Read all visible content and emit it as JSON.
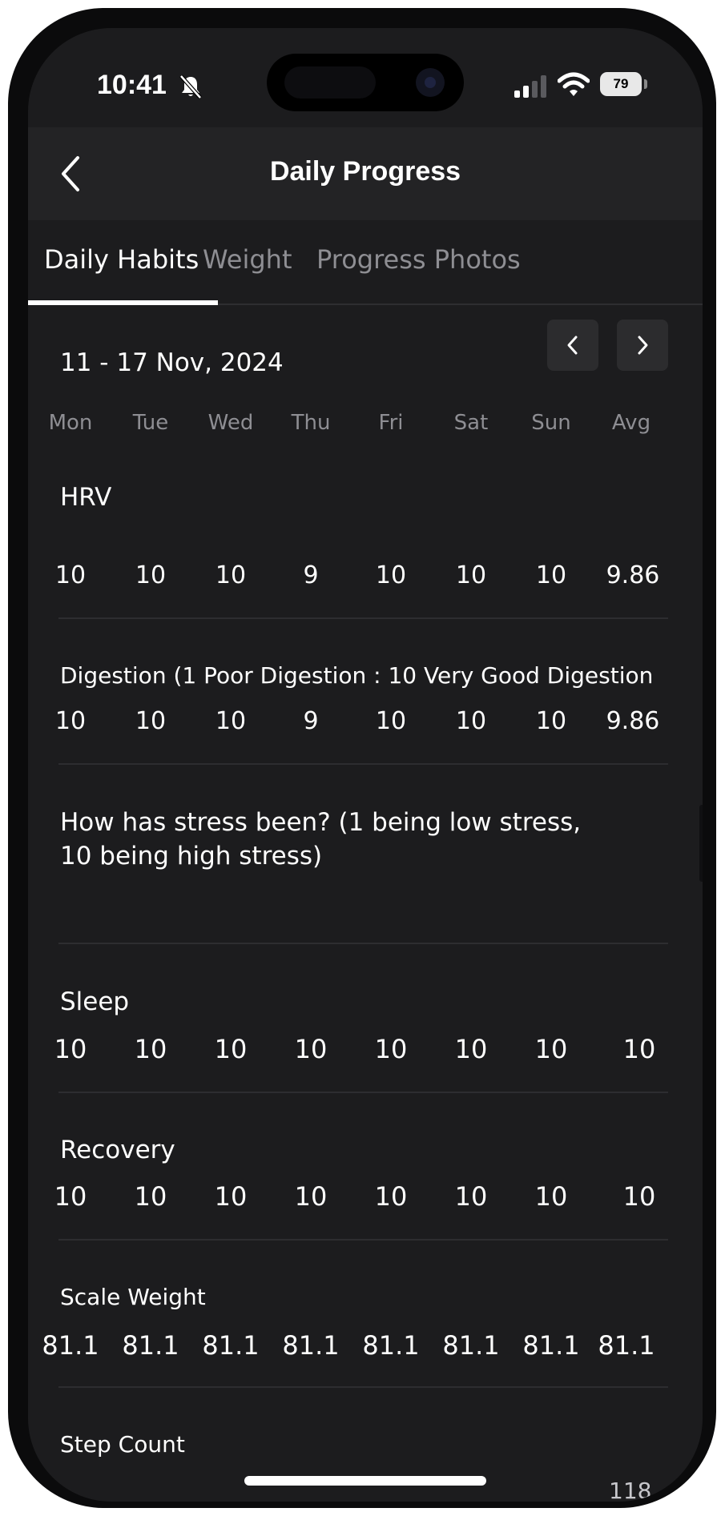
{
  "status_bar": {
    "time": "10:41",
    "battery": "79"
  },
  "nav": {
    "title": "Daily Progress"
  },
  "tabs": [
    {
      "label": "Daily Habits",
      "active": true
    },
    {
      "label": "Weight",
      "active": false
    },
    {
      "label": "Progress Photos",
      "active": false
    }
  ],
  "week": {
    "range": "11 - 17 Nov, 2024",
    "days": [
      "Mon",
      "Tue",
      "Wed",
      "Thu",
      "Fri",
      "Sat",
      "Sun",
      "Avg"
    ]
  },
  "sections": [
    {
      "title": "HRV",
      "values": [
        "10",
        "10",
        "10",
        "9",
        "10",
        "10",
        "10",
        "9.86"
      ]
    },
    {
      "title": "Digestion (1 Poor Digestion : 10 Very Good Digestion",
      "values": [
        "10",
        "10",
        "10",
        "9",
        "10",
        "10",
        "10",
        "9.86"
      ]
    },
    {
      "title_line1": "How has stress been? (1 being low stress,",
      "title_line2": "10 being high stress)",
      "values": []
    },
    {
      "title": "Sleep",
      "values": [
        "10",
        "10",
        "10",
        "10",
        "10",
        "10",
        "10",
        "10"
      ]
    },
    {
      "title": "Recovery",
      "values": [
        "10",
        "10",
        "10",
        "10",
        "10",
        "10",
        "10",
        "10"
      ]
    },
    {
      "title": "Scale Weight",
      "values": [
        "81.1",
        "81.1",
        "81.1",
        "81.1",
        "81.1",
        "81.1",
        "81.1",
        "81.1"
      ]
    },
    {
      "title": "Step Count",
      "values": [],
      "partial_value": "118"
    }
  ],
  "colors": {
    "background": "#1c1c1e",
    "nav_bar": "#232325",
    "muted_text": "#8e8e93",
    "divider": "#2d2d30"
  },
  "icons": [
    "bell-slash-icon",
    "cellular-signal-icon",
    "wifi-icon",
    "battery-icon",
    "chevron-left-icon",
    "chevron-right-icon"
  ]
}
